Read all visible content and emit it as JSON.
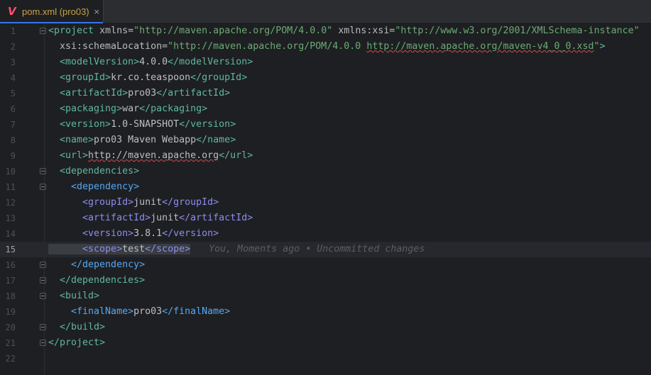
{
  "tab": {
    "icon": "maven-icon",
    "label": "pom.xml (pro03)",
    "close": "×"
  },
  "lines": [
    {
      "n": "1",
      "parts": [
        [
          "t",
          "<project "
        ],
        [
          "a",
          "xmlns="
        ],
        [
          "s",
          "\"http://maven.apache.org/POM/4.0.0\""
        ],
        [
          "a",
          " xmlns:xsi="
        ],
        [
          "s",
          "\"http://www.w3.org/2001/XMLSchema-instance\""
        ]
      ]
    },
    {
      "n": "2",
      "parts": [
        [
          "a",
          "  xsi:schemaLocation="
        ],
        [
          "s",
          "\"http://maven.apache.org/POM/4.0.0 "
        ],
        [
          "su",
          "http://maven.apache.org/maven-v4_0_0.xsd"
        ],
        [
          "s",
          "\""
        ],
        [
          "t",
          ">"
        ]
      ]
    },
    {
      "n": "3",
      "parts": [
        [
          "t",
          "  <modelVersion>"
        ],
        [
          "tx",
          "4.0.0"
        ],
        [
          "t",
          "</modelVersion>"
        ]
      ]
    },
    {
      "n": "4",
      "parts": [
        [
          "t",
          "  <groupId>"
        ],
        [
          "tx",
          "kr.co.teaspoon"
        ],
        [
          "t",
          "</groupId>"
        ]
      ]
    },
    {
      "n": "5",
      "parts": [
        [
          "t",
          "  <artifactId>"
        ],
        [
          "tx",
          "pro03"
        ],
        [
          "t",
          "</artifactId>"
        ]
      ]
    },
    {
      "n": "6",
      "parts": [
        [
          "t",
          "  <packaging>"
        ],
        [
          "tx",
          "war"
        ],
        [
          "t",
          "</packaging>"
        ]
      ]
    },
    {
      "n": "7",
      "parts": [
        [
          "t",
          "  <version>"
        ],
        [
          "tx",
          "1.0-SNAPSHOT"
        ],
        [
          "t",
          "</version>"
        ]
      ]
    },
    {
      "n": "8",
      "parts": [
        [
          "t",
          "  <name>"
        ],
        [
          "tx",
          "pro03 Maven Webapp"
        ],
        [
          "t",
          "</name>"
        ]
      ]
    },
    {
      "n": "9",
      "parts": [
        [
          "t",
          "  <url>"
        ],
        [
          "txu",
          "http://maven.apache.org"
        ],
        [
          "t",
          "</url>"
        ]
      ]
    },
    {
      "n": "10",
      "parts": [
        [
          "t",
          "  <dependencies>"
        ]
      ]
    },
    {
      "n": "11",
      "parts": [
        [
          "t2",
          "    <dependency>"
        ]
      ]
    },
    {
      "n": "12",
      "parts": [
        [
          "t3",
          "      <groupId>"
        ],
        [
          "tx",
          "junit"
        ],
        [
          "t3",
          "</groupId>"
        ]
      ]
    },
    {
      "n": "13",
      "parts": [
        [
          "t3",
          "      <artifactId>"
        ],
        [
          "tx",
          "junit"
        ],
        [
          "t3",
          "</artifactId>"
        ]
      ]
    },
    {
      "n": "14",
      "parts": [
        [
          "t3",
          "      <version>"
        ],
        [
          "tx",
          "3.8.1"
        ],
        [
          "t3",
          "</version>"
        ]
      ]
    },
    {
      "n": "15",
      "parts": [
        [
          "t3",
          "      <scope>"
        ],
        [
          "tx",
          "test"
        ],
        [
          "t3",
          "</scope>"
        ]
      ],
      "blame": "You, Moments ago • Uncommitted changes"
    },
    {
      "n": "16",
      "parts": [
        [
          "t2",
          "    </dependency>"
        ]
      ]
    },
    {
      "n": "17",
      "parts": [
        [
          "t",
          "  </dependencies>"
        ]
      ]
    },
    {
      "n": "18",
      "parts": [
        [
          "t",
          "  <build>"
        ]
      ]
    },
    {
      "n": "19",
      "parts": [
        [
          "t2",
          "    <finalName>"
        ],
        [
          "tx",
          "pro03"
        ],
        [
          "t2",
          "</finalName>"
        ]
      ]
    },
    {
      "n": "20",
      "parts": [
        [
          "t",
          "  </build>"
        ]
      ]
    },
    {
      "n": "21",
      "parts": [
        [
          "t",
          "</project>"
        ]
      ]
    },
    {
      "n": "22",
      "parts": []
    }
  ],
  "current_line": "15",
  "colors": {
    "tag": "#5fb8a0",
    "tag_nested": "#56a8f5",
    "tag_deep": "#8c8ef0",
    "string": "#6aab73",
    "text": "#bcbec4",
    "background": "#1e1f22"
  },
  "icons": {
    "intention": "lightbulb-icon"
  }
}
